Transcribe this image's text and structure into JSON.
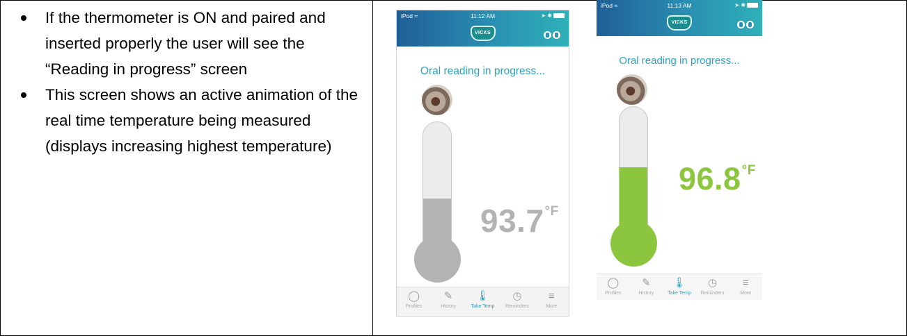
{
  "left_cell": {
    "bullets": [
      "If the thermometer is ON and paired and inserted properly the user will see the “Reading in progress” screen",
      "This screen shows an active animation of the real time temperature being measured (displays increasing highest temperature)"
    ]
  },
  "phones": [
    {
      "status": {
        "carrier": "iPod ≈",
        "time": "11:12 AM",
        "right": "➤ ✱"
      },
      "logo": "VICKS",
      "reading_text": "Oral reading in progress...",
      "temperature": "93.7",
      "unit": "°F",
      "fill_fraction": 0.43,
      "accent_color": "#b3b3b3",
      "tabs": [
        {
          "label": "Profiles",
          "icon": "person-icon"
        },
        {
          "label": "History",
          "icon": "history-icon"
        },
        {
          "label": "Take Temp",
          "icon": "thermometer-icon"
        },
        {
          "label": "Reminders",
          "icon": "clock-icon"
        },
        {
          "label": "More",
          "icon": "menu-icon"
        }
      ]
    },
    {
      "status": {
        "carrier": "iPod ≈",
        "time": "11:13 AM",
        "right": "➤ ✱"
      },
      "logo": "VICKS",
      "reading_text": "Oral reading in progress...",
      "temperature": "96.8",
      "unit": "°F",
      "fill_fraction": 0.55,
      "accent_color": "#8cc63f",
      "tabs": [
        {
          "label": "Profiles",
          "icon": "person-icon"
        },
        {
          "label": "History",
          "icon": "history-icon"
        },
        {
          "label": "Take Temp",
          "icon": "thermometer-icon"
        },
        {
          "label": "Reminders",
          "icon": "clock-icon"
        },
        {
          "label": "More",
          "icon": "menu-icon"
        }
      ]
    }
  ]
}
